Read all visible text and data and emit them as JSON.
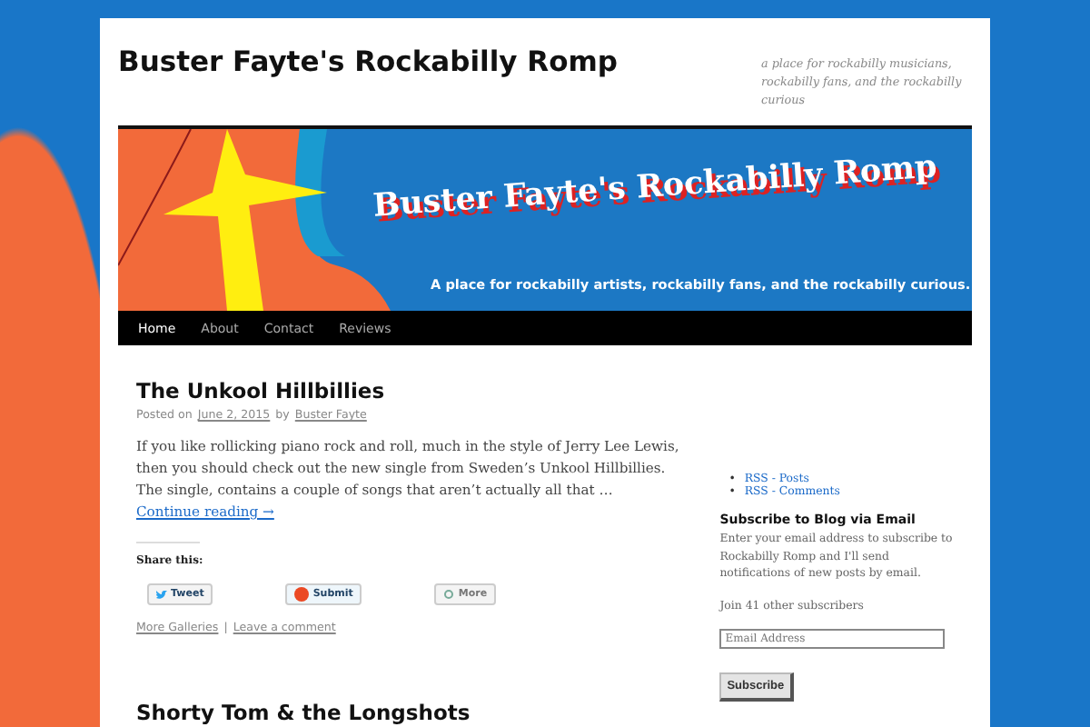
{
  "site": {
    "title": "Buster Fayte's Rockabilly Romp",
    "tagline": "a place for rockabilly musicians, rockabilly fans, and the rockabilly curious"
  },
  "banner": {
    "title": "Buster Fayte's Rockabilly Romp",
    "subtitle": "A place for rockabilly artists, rockabilly fans, and the rockabilly curious."
  },
  "nav": [
    {
      "label": "Home",
      "selected": true
    },
    {
      "label": "About",
      "selected": false
    },
    {
      "label": "Contact",
      "selected": false
    },
    {
      "label": "Reviews",
      "selected": false
    }
  ],
  "posts": [
    {
      "title": "The Unkool Hillbillies",
      "posted_on": "Posted on",
      "date": "June 2, 2015",
      "by": "by",
      "author": "Buster Fayte",
      "excerpt": "If you like rollicking piano rock and roll, much in the style of Jerry Lee Lewis, then you should check out the new single from Sweden’s Unkool Hillbillies. The single, contains a couple of songs that aren’t actually all that …",
      "more_link": "Continue reading →",
      "share_heading": "Share this:",
      "share_buttons": [
        {
          "kind": "twitter",
          "label": "Tweet"
        },
        {
          "kind": "stumble",
          "label": "Submit"
        },
        {
          "kind": "more",
          "label": "More"
        }
      ],
      "category": "More Galleries",
      "separator": "|",
      "comments": "Leave a comment"
    },
    {
      "title": "Shorty Tom & the Longshots"
    }
  ],
  "sidebar": {
    "rss_bullet": "•",
    "rss_links": [
      "RSS - Posts",
      "RSS - Comments"
    ],
    "subscribe": {
      "heading": "Subscribe to Blog via Email",
      "text": "Enter your email address to subscribe to Rockabilly Romp and I'll send notifications of new posts by email.",
      "subscribers": "Join 41 other subscribers",
      "placeholder": "Email Address",
      "button": "Subscribe"
    }
  }
}
